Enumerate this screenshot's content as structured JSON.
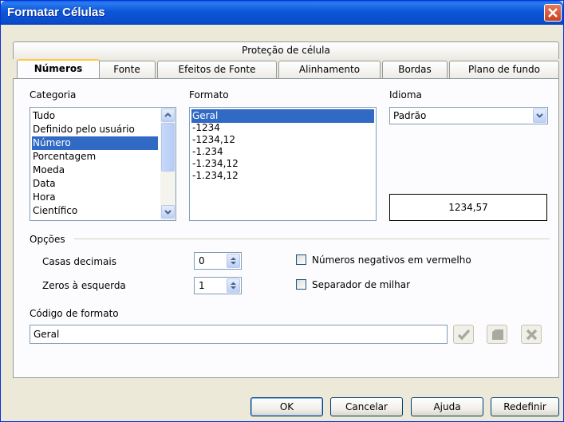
{
  "window": {
    "title": "Formatar Células"
  },
  "tabs_top": [
    {
      "label": "Proteção de célula"
    }
  ],
  "tabs_bottom": [
    {
      "label": "Números"
    },
    {
      "label": "Fonte"
    },
    {
      "label": "Efeitos de Fonte"
    },
    {
      "label": "Alinhamento"
    },
    {
      "label": "Bordas"
    },
    {
      "label": "Plano de fundo"
    }
  ],
  "categoria": {
    "label": "Categoria",
    "items": [
      "Tudo",
      "Definido pelo usuário",
      "Número",
      "Porcentagem",
      "Moeda",
      "Data",
      "Hora",
      "Científico"
    ],
    "selected": "Número"
  },
  "formato": {
    "label": "Formato",
    "items": [
      "Geral",
      "-1234",
      "-1234,12",
      "-1.234",
      "-1.234,12",
      "-1.234,12"
    ],
    "selected": "Geral"
  },
  "idioma": {
    "label": "Idioma",
    "value": "Padrão"
  },
  "preview": {
    "value": "1234,57"
  },
  "opcoes": {
    "label": "Opções",
    "casas_decimais": {
      "label": "Casas decimais",
      "value": "0"
    },
    "zeros_esquerda": {
      "label": "Zeros à esquerda",
      "value": "1"
    },
    "negativos_vermelho": {
      "label": "Números negativos em vermelho",
      "checked": false
    },
    "separador_milhar": {
      "label": "Separador de milhar",
      "checked": false
    }
  },
  "codigo_formato": {
    "label": "Código de formato",
    "value": "Geral"
  },
  "buttons": {
    "ok": "OK",
    "cancelar": "Cancelar",
    "ajuda": "Ajuda",
    "redefinir": "Redefinir"
  },
  "icons": [
    "close-icon",
    "check-icon",
    "comment-icon",
    "delete-icon",
    "scroll-up-icon",
    "scroll-down-icon",
    "dropdown-arrow-icon",
    "spin-arrows-icon"
  ]
}
